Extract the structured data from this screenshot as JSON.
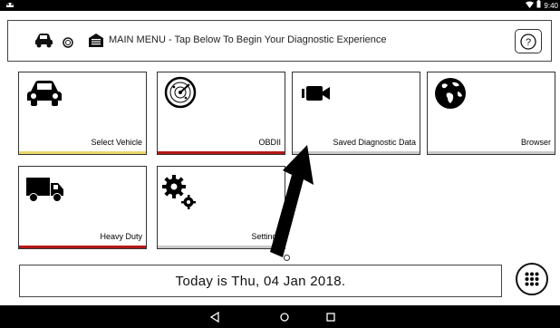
{
  "status_bar": {
    "time": "9:40",
    "icons": [
      "app-notification-icon",
      "wifi-icon",
      "battery-icon"
    ]
  },
  "header": {
    "title": "MAIN MENU - Tap Below To Begin Your Diagnostic Experience",
    "help_label": "?",
    "icons": [
      "car-icon",
      "tire-icon",
      "garage-icon",
      "help-icon"
    ]
  },
  "tiles": [
    {
      "label": "Select Vehicle",
      "icon": "car-icon",
      "bar_color": "#e8d76a"
    },
    {
      "label": "OBDII",
      "icon": "radar-gauge-icon",
      "bar_color": "#b51818"
    },
    {
      "label": "Saved Diagnostic Data",
      "icon": "video-camera-icon",
      "bar_color": "#c9c9c9"
    },
    {
      "label": "Browser",
      "icon": "globe-icon",
      "bar_color": "#c9c9c9"
    },
    {
      "label": "Heavy Duty",
      "icon": "truck-icon",
      "bar_color": "#b51818"
    },
    {
      "label": "Settings",
      "icon": "gears-icon",
      "bar_color": "#c9c9c9"
    }
  ],
  "date_text": "Today is Thu, 04 Jan 2018.",
  "apps_button": {
    "icon": "apps-grid-icon"
  },
  "nav": {
    "icons": [
      "back-icon",
      "home-icon",
      "recents-icon"
    ]
  }
}
